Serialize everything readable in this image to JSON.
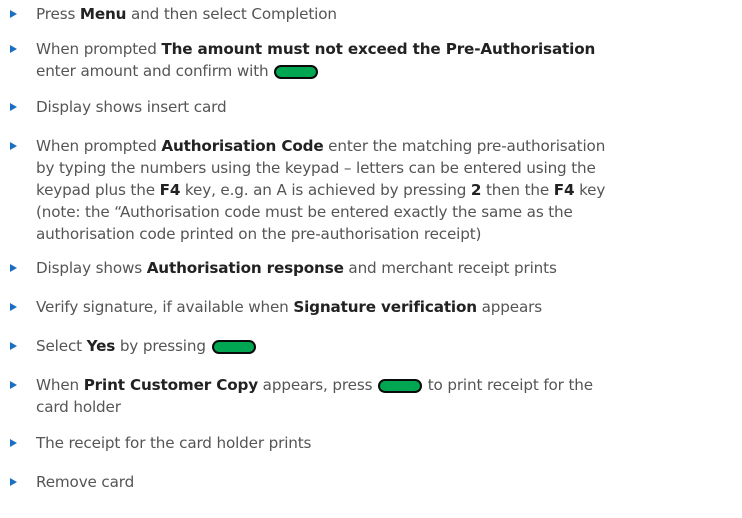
{
  "steps": [
    {
      "parts": [
        {
          "t": "Press "
        },
        {
          "b": "Menu"
        },
        {
          "t": " and then select Completion"
        }
      ]
    },
    {
      "parts": [
        {
          "t": "When prompted "
        },
        {
          "b": "The amount must not exceed the Pre-Authorisation"
        },
        {
          "br": true
        },
        {
          "t": "enter amount and confirm with "
        },
        {
          "key": "green-button"
        }
      ]
    },
    {
      "parts": [
        {
          "t": "Display shows insert card"
        }
      ]
    },
    {
      "parts": [
        {
          "t": "When prompted "
        },
        {
          "b": "Authorisation Code"
        },
        {
          "t": " enter the matching pre-authorisation"
        },
        {
          "br": true
        },
        {
          "t": "by typing the numbers using the keypad – letters can be entered using the"
        },
        {
          "br": true
        },
        {
          "t": "keypad plus the "
        },
        {
          "b": "F4"
        },
        {
          "t": " key, e.g. an A is achieved by pressing "
        },
        {
          "b": "2"
        },
        {
          "t": " then the "
        },
        {
          "b": "F4"
        },
        {
          "t": " key"
        },
        {
          "br": true
        },
        {
          "t": "(note: the “Authorisation code must be entered exactly the same as the"
        },
        {
          "br": true
        },
        {
          "t": "authorisation code printed on the pre-authorisation receipt)"
        }
      ]
    },
    {
      "parts": [
        {
          "t": "Display shows "
        },
        {
          "b": "Authorisation response"
        },
        {
          "t": " and merchant receipt prints"
        }
      ]
    },
    {
      "parts": [
        {
          "t": "Verify signature, if available when "
        },
        {
          "b": "Signature verification"
        },
        {
          "t": " appears"
        }
      ]
    },
    {
      "parts": [
        {
          "t": "Select "
        },
        {
          "b": "Yes"
        },
        {
          "t": " by pressing "
        },
        {
          "key": "green-button"
        }
      ]
    },
    {
      "parts": [
        {
          "t": "When "
        },
        {
          "b": "Print Customer Copy"
        },
        {
          "t": " appears, press "
        },
        {
          "key": "green-button"
        },
        {
          "t": " to print receipt for the"
        },
        {
          "br": true
        },
        {
          "t": "card holder"
        }
      ]
    },
    {
      "parts": [
        {
          "t": "The receipt for the card holder prints"
        }
      ]
    },
    {
      "parts": [
        {
          "t": "Remove card"
        }
      ]
    }
  ],
  "colors": {
    "text": "#555555",
    "bold_text": "#222222",
    "bullet": "#1a6fc4",
    "key_fill": "#00a651",
    "key_border": "#0a0a0a"
  },
  "icons": {
    "bullet": "triangle-bullet-icon",
    "key": "green-confirm-key-icon"
  }
}
